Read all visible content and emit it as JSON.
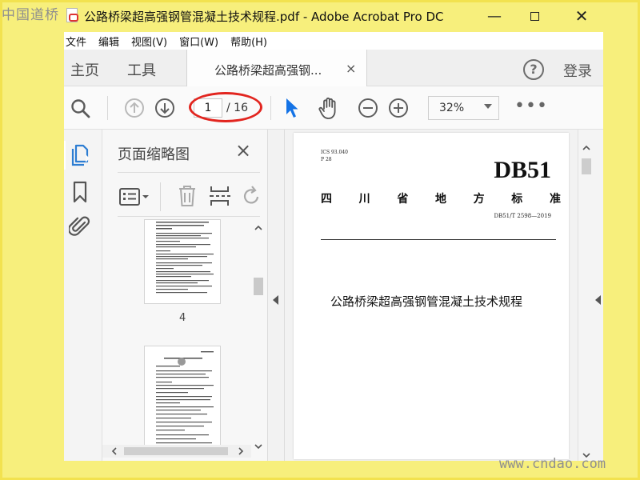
{
  "watermarks": {
    "top_left": "中国道桥",
    "bottom_right": "www.cndao.com"
  },
  "window": {
    "title": "公路桥梁超高强钢管混凝土技术规程.pdf - Adobe Acrobat Pro DC",
    "controls": {
      "minimize": "—",
      "close": "✕"
    }
  },
  "menu": [
    "文件",
    "编辑",
    "视图(V)",
    "窗口(W)",
    "帮助(H)"
  ],
  "tabs": {
    "home": "主页",
    "tools": "工具",
    "document": "公路桥梁超高强钢...",
    "close": "×",
    "login": "登录",
    "help": "?"
  },
  "toolbar": {
    "current_page": "1",
    "total_pages": "/ 16",
    "zoom": "32%",
    "more": "•••",
    "icons": [
      "search-icon",
      "prev-page-icon",
      "next-page-icon",
      "select-cursor-icon",
      "hand-tool-icon",
      "zoom-out-icon",
      "zoom-in-icon"
    ]
  },
  "annotation": {
    "highlight_color": "#e2251f",
    "target": "page-number-field"
  },
  "left_rail": {
    "icons": [
      "page-thumbnails-icon",
      "bookmarks-icon",
      "attachments-icon"
    ]
  },
  "thumbnail_panel": {
    "title": "页面缩略图",
    "close": "×",
    "tools": [
      "options-menu-icon",
      "delete-page-icon",
      "insert-page-icon",
      "rotate-icon"
    ],
    "thumbnails": [
      {
        "label": "4"
      },
      {
        "label": ""
      }
    ]
  },
  "document_page": {
    "ics": "ICS 93.040",
    "category": "P 28",
    "code": "DB51",
    "province_chars": [
      "四",
      "川",
      "省",
      "地",
      "方",
      "标",
      "准"
    ],
    "standard_number": "DB51/T 2598—2019",
    "title": "公路桥梁超高强钢管混凝土技术规程"
  },
  "colors": {
    "acrobat_accent": "#2d7dd2",
    "tool_active": "#1473e6",
    "icon_gray": "#6b6b6b"
  }
}
